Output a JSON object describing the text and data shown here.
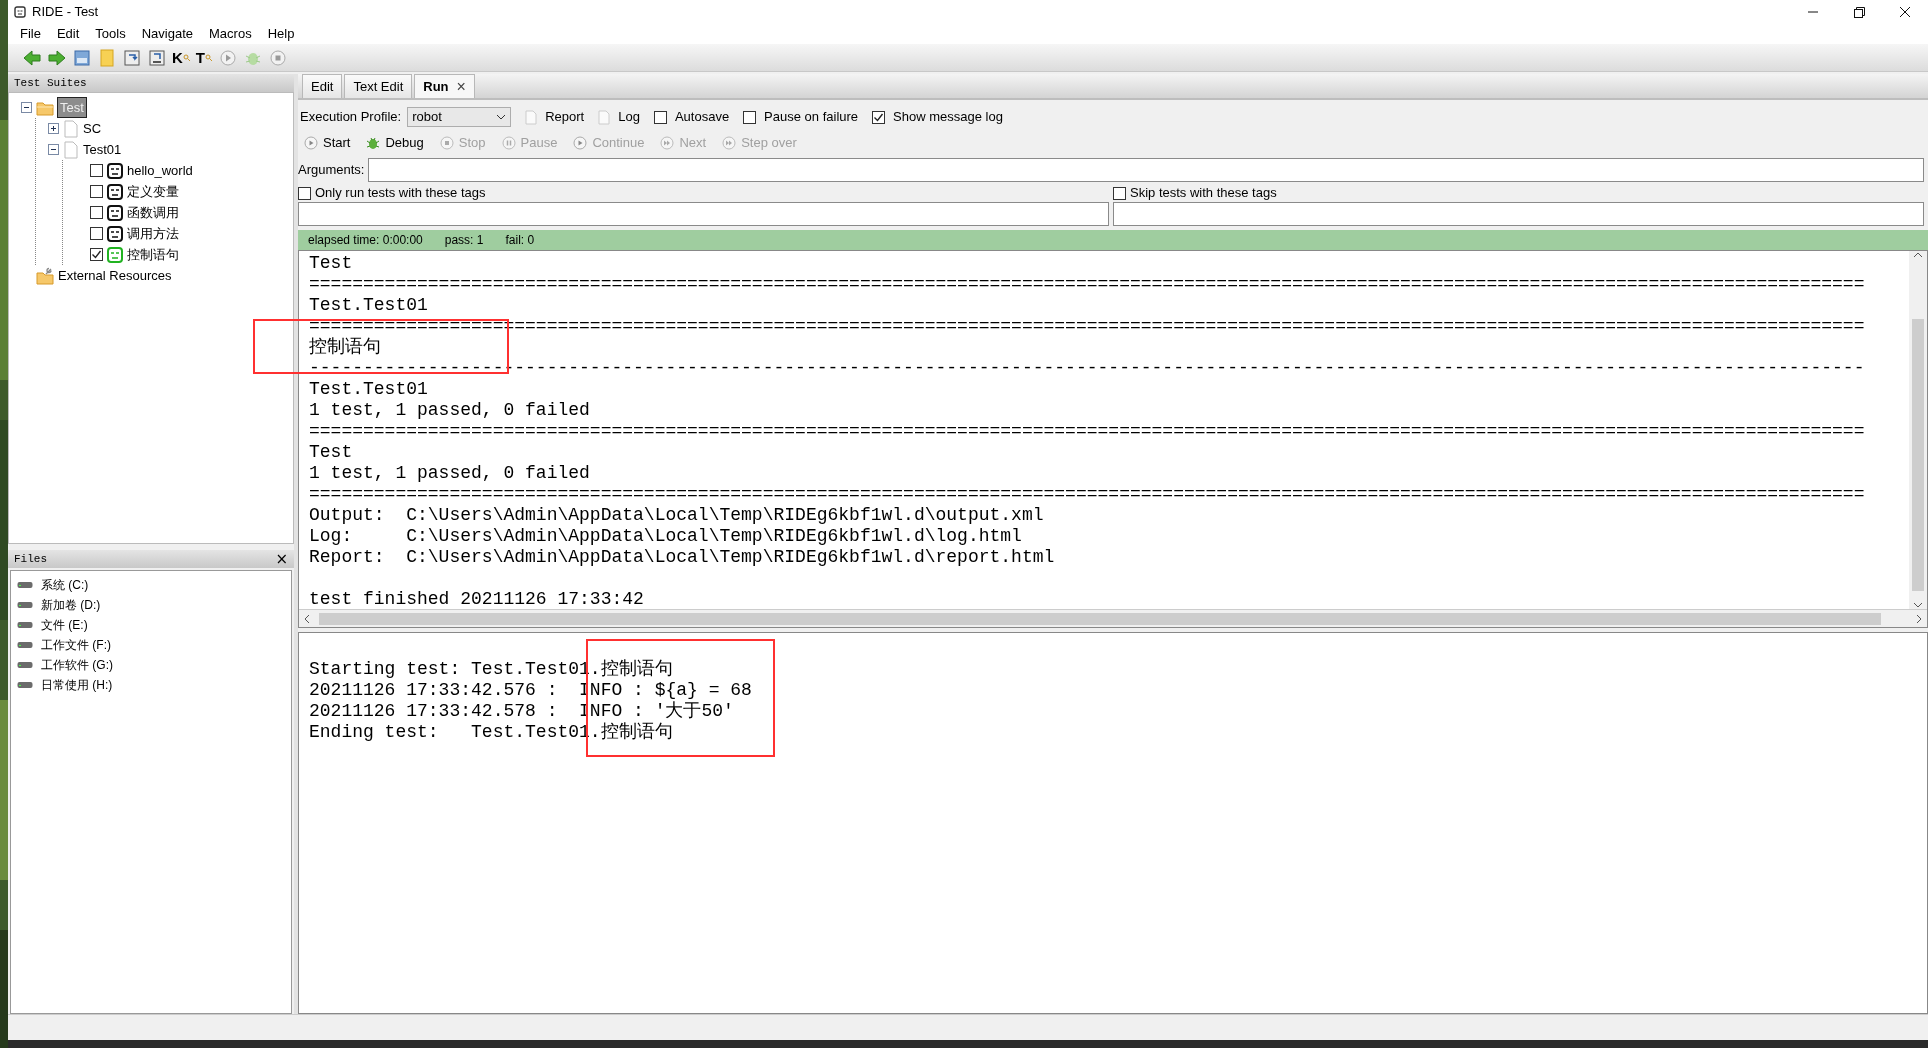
{
  "window": {
    "title": "RIDE - Test"
  },
  "menu": [
    "File",
    "Edit",
    "Tools",
    "Navigate",
    "Macros",
    "Help"
  ],
  "toolbar_glyphs": [
    "K",
    "T"
  ],
  "test_suites": {
    "title": "Test Suites",
    "tree": [
      {
        "label": "Test",
        "kind": "folder",
        "selected": true,
        "expanded": true,
        "children": [
          {
            "label": "SC",
            "kind": "file",
            "selected": false,
            "expanded": false
          },
          {
            "label": "Test01",
            "kind": "file",
            "selected": false,
            "expanded": true,
            "children": [
              {
                "label": "hello_world",
                "kind": "test",
                "selected": false,
                "checked": false,
                "passed": false
              },
              {
                "label": "定义变量",
                "kind": "test",
                "selected": false,
                "checked": false,
                "passed": false
              },
              {
                "label": "函数调用",
                "kind": "test",
                "selected": false,
                "checked": false,
                "passed": false
              },
              {
                "label": "调用方法",
                "kind": "test",
                "selected": false,
                "checked": false,
                "passed": false
              },
              {
                "label": "控制语句",
                "kind": "test",
                "selected": false,
                "checked": true,
                "passed": true
              }
            ]
          }
        ]
      },
      {
        "label": "External Resources",
        "kind": "resources",
        "selected": false
      }
    ]
  },
  "files": {
    "title": "Files",
    "close": "×",
    "drives": [
      "系统 (C:)",
      "新加卷 (D:)",
      "文件 (E:)",
      "工作文件 (F:)",
      "工作软件 (G:)",
      "日常使用 (H:)"
    ]
  },
  "tabs": [
    {
      "label": "Edit",
      "selected": false,
      "closable": false
    },
    {
      "label": "Text Edit",
      "selected": false,
      "closable": false
    },
    {
      "label": "Run",
      "selected": true,
      "closable": true,
      "close": "×"
    }
  ],
  "run": {
    "profile_label": "Execution Profile:",
    "profile": "robot",
    "options": [
      {
        "kind": "button",
        "label": "Report"
      },
      {
        "kind": "button",
        "label": "Log"
      },
      {
        "kind": "checkbox",
        "label": "Autosave",
        "checked": false
      },
      {
        "kind": "checkbox",
        "label": "Pause on failure",
        "checked": false
      },
      {
        "kind": "checkbox",
        "label": "Show message log",
        "checked": true
      }
    ],
    "actions": [
      {
        "label": "Start",
        "disabled": false,
        "kind": "play"
      },
      {
        "label": "Debug",
        "disabled": false,
        "kind": "bug"
      },
      {
        "label": "Stop",
        "disabled": true,
        "kind": "stop"
      },
      {
        "label": "Pause",
        "disabled": true,
        "kind": "pause"
      },
      {
        "label": "Continue",
        "disabled": true,
        "kind": "play"
      },
      {
        "label": "Next",
        "disabled": true,
        "kind": "next"
      },
      {
        "label": "Step over",
        "disabled": true,
        "kind": "next"
      }
    ],
    "arguments_label": "Arguments:",
    "tag_filters": [
      {
        "label": "Only run tests with these tags",
        "checked": false
      },
      {
        "label": "Skip tests with these tags",
        "checked": false
      }
    ],
    "status": {
      "all_passed": true,
      "elapsed": "elapsed time: 0:00:00",
      "pass": "pass: 1",
      "fail": "fail: 0"
    },
    "output": [
      {
        "text": "Test",
        "highlighted": false
      },
      {
        "text": "================================================================================================================================================",
        "highlighted": false
      },
      {
        "text": "Test.Test01",
        "highlighted": false
      },
      {
        "text": "================================================================================================================================================",
        "highlighted": false
      },
      {
        "text": "控制语句",
        "highlighted": true
      },
      {
        "text": "------------------------------------------------------------------------------------------------------------------------------------------------",
        "highlighted": false
      },
      {
        "text": "Test.Test01",
        "highlighted": false
      },
      {
        "text": "1 test, 1 passed, 0 failed",
        "highlighted": false
      },
      {
        "text": "================================================================================================================================================",
        "highlighted": false
      },
      {
        "text": "Test",
        "highlighted": false
      },
      {
        "text": "1 test, 1 passed, 0 failed",
        "highlighted": false
      },
      {
        "text": "================================================================================================================================================",
        "highlighted": false
      },
      {
        "text": "Output:  C:\\Users\\Admin\\AppData\\Local\\Temp\\RIDEg6kbf1wl.d\\output.xml",
        "highlighted": false
      },
      {
        "text": "Log:     C:\\Users\\Admin\\AppData\\Local\\Temp\\RIDEg6kbf1wl.d\\log.html",
        "highlighted": false
      },
      {
        "text": "Report:  C:\\Users\\Admin\\AppData\\Local\\Temp\\RIDEg6kbf1wl.d\\report.html",
        "highlighted": false
      },
      {
        "text": "test finished 20211126 17:33:42",
        "highlighted": false,
        "space_before": true
      }
    ],
    "message_log": {
      "highlighted": true,
      "lines": [
        "Starting test: Test.Test01.控制语句",
        "20211126 17:33:42.576 :  INFO : ${a} = 68",
        "20211126 17:33:42.578 :  INFO : '大于50'",
        "Ending test:   Test.Test01.控制语句"
      ]
    }
  }
}
